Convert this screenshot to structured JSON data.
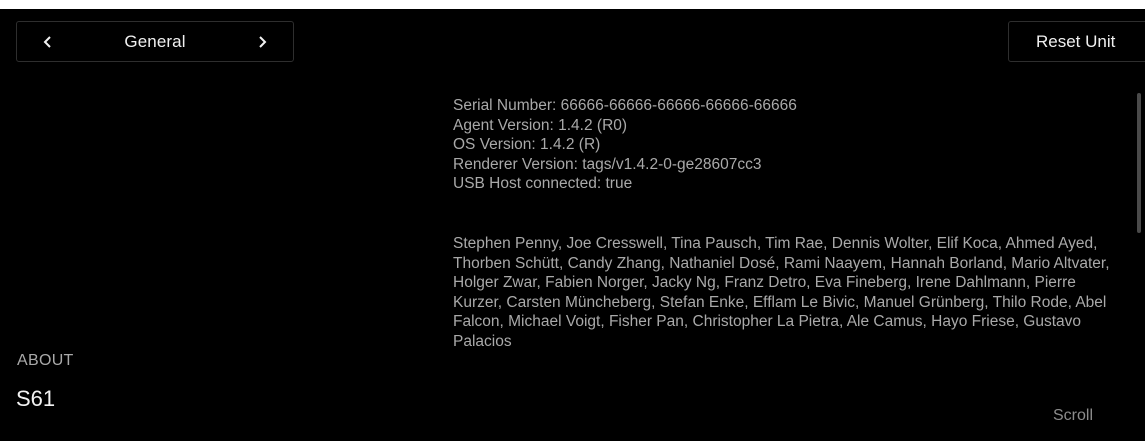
{
  "header": {
    "page_title": "General",
    "reset_label": "Reset Unit",
    "prev_icon": "chevron-left-icon",
    "next_icon": "chevron-right-icon"
  },
  "info": {
    "serial": "Serial Number: 66666-66666-66666-66666-66666",
    "agent_version": "Agent Version: 1.4.2 (R0)",
    "os_version": "OS Version: 1.4.2 (R)",
    "renderer_version": "Renderer Version: tags/v1.4.2-0-ge28607cc3",
    "usb_host": "USB Host connected: true"
  },
  "credits": {
    "text": "Stephen Penny, Joe Cresswell, Tina Pausch, Tim Rae, Dennis Wolter, Elif Koca, Ahmed Ayed, Thorben Schütt, Candy Zhang, Nathaniel Dosé, Rami Naayem, Hannah Borland, Mario Altvater, Holger Zwar, Fabien Norger, Jacky Ng, Franz Detro, Eva Fineberg, Irene Dahlmann, Pierre Kurzer, Carsten Müncheberg, Stefan Enke, Efflam Le Bivic, Manuel Grünberg, Thilo Rode, Abel Falcon, Michael Voigt, Fisher Pan, Christopher La Pietra, Ale Camus, Hayo Friese, Gustavo Palacios"
  },
  "footer": {
    "section_label": "ABOUT",
    "device_name": "S61",
    "scroll_hint": "Scroll"
  },
  "colors": {
    "background": "#000000",
    "primary_text": "#f0f0f0",
    "secondary_text": "#a9a9a9",
    "border": "#2e2e2e"
  }
}
